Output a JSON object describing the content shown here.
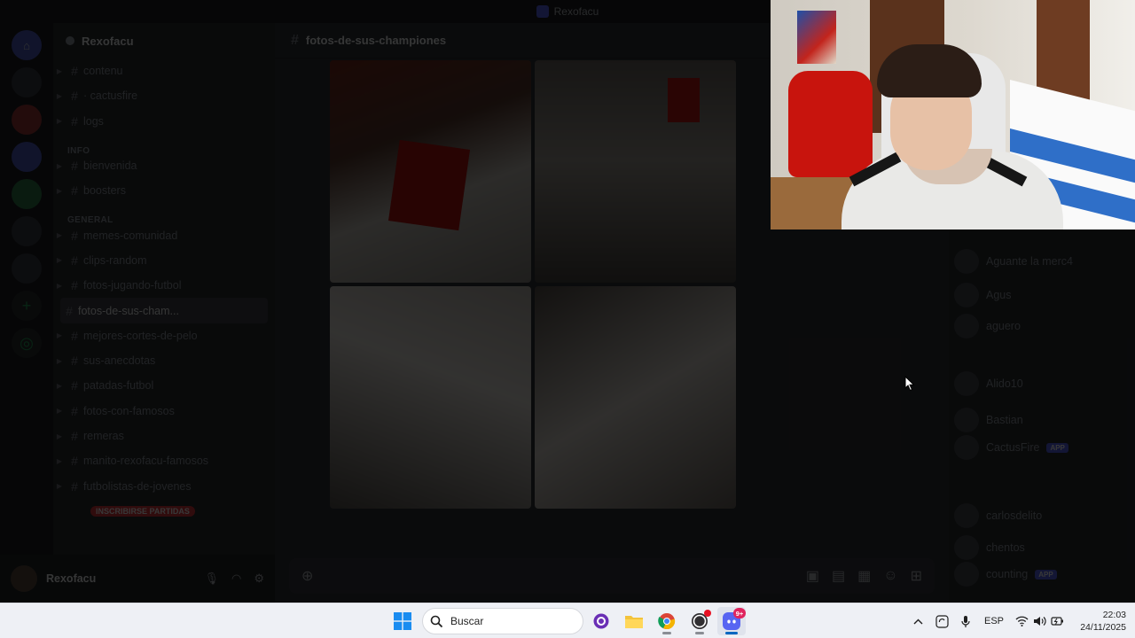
{
  "titlebar": {
    "app_title": "Rexofacu"
  },
  "servers": [
    {
      "label": "",
      "icon": "home-icon"
    },
    {
      "label": ""
    },
    {
      "label": ""
    },
    {
      "label": ""
    },
    {
      "label": ""
    },
    {
      "label": ""
    },
    {
      "label": ""
    },
    {
      "label": ""
    }
  ],
  "sidebar": {
    "guild_name": "Rexofacu",
    "top_channels": [
      {
        "name": "contenu"
      },
      {
        "name": "· cactusfire"
      },
      {
        "name": "logs"
      }
    ],
    "category_2": "INFO",
    "info_channels": [
      {
        "name": "bienvenida"
      },
      {
        "name": "boosters"
      }
    ],
    "category_3": "GENERAL",
    "channels": [
      {
        "name": "memes-comunidad",
        "active": false
      },
      {
        "name": "clips-random",
        "active": false
      },
      {
        "name": "fotos-jugando-futbol",
        "active": false
      },
      {
        "name": "fotos-de-sus-cham...",
        "active": true
      },
      {
        "name": "mejores-cortes-de-pelo",
        "active": false
      },
      {
        "name": "sus-anecdotas",
        "active": false
      },
      {
        "name": "patadas-futbol",
        "active": false
      },
      {
        "name": "fotos-con-famosos",
        "active": false
      },
      {
        "name": "remeras",
        "active": false
      },
      {
        "name": "manito-rexofacu-famosos",
        "active": false
      },
      {
        "name": "futbolistas-de-jovenes",
        "active": false
      }
    ],
    "event_badge": "INSCRIBIRSE PARTIDAS"
  },
  "user_panel": {
    "name": "Rexofacu",
    "status": ""
  },
  "main": {
    "channel_name": "fotos-de-sus-championes",
    "typing_text": ""
  },
  "members": [
    {
      "name": "Aguante la merc4",
      "tag": ""
    },
    {
      "name": "Agus",
      "tag": ""
    },
    {
      "name": "aguero",
      "tag": ""
    },
    {
      "name": "Alido10",
      "tag": ""
    },
    {
      "name": "Bastian",
      "tag": ""
    },
    {
      "name": "CactusFire",
      "tag": "APP"
    },
    {
      "name": "carlosdelito",
      "tag": ""
    },
    {
      "name": "chentos",
      "tag": ""
    },
    {
      "name": "counting",
      "tag": "APP"
    }
  ],
  "taskbar": {
    "search_placeholder": "Buscar",
    "discord_badge": "9+",
    "language": "ESP",
    "time": "22:03",
    "date": "24/11/2025"
  },
  "colors": {
    "discord_accent": "#5865f2",
    "taskbar_bg": "#eef0f5",
    "windows_blue": "#0067c0"
  }
}
